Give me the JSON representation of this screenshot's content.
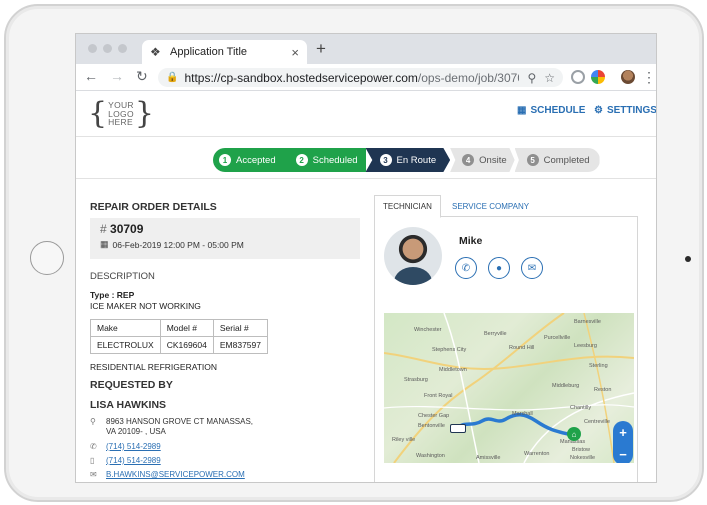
{
  "browser": {
    "tab_title": "Application Title",
    "tab_close": "×",
    "new_tab": "+",
    "url_host": "https://cp-sandbox.hostedservicepower.com",
    "url_path": "/ops-demo/job/3070..."
  },
  "header": {
    "logo_lines": [
      "YOUR",
      "LOGO",
      "HERE"
    ],
    "schedule_label": "SCHEDULE",
    "settings_label": "SETTINGS"
  },
  "status_steps": [
    {
      "num": "1",
      "label": "Accepted",
      "state": "done"
    },
    {
      "num": "2",
      "label": "Scheduled",
      "state": "done"
    },
    {
      "num": "3",
      "label": "En Route",
      "state": "current"
    },
    {
      "num": "4",
      "label": "Onsite",
      "state": "todo"
    },
    {
      "num": "5",
      "label": "Completed",
      "state": "todo"
    }
  ],
  "repair_order": {
    "heading": "REPAIR ORDER DETAILS",
    "hash": "#",
    "number": "30709",
    "date": "06-Feb-2019 12:00 PM - 05:00 PM"
  },
  "description": {
    "heading": "DESCRIPTION",
    "type": "Type : REP",
    "text": "ICE MAKER NOT WORKING",
    "columns": [
      "Make",
      "Model #",
      "Serial #"
    ],
    "row": [
      "ELECTROLUX",
      "CK169604",
      "EM837597"
    ],
    "category": "RESIDENTIAL REFRIGERATION"
  },
  "requested_by": {
    "heading": "REQUESTED BY",
    "name": "LISA HAWKINS",
    "address_line1": "8963 HANSON GROVE CT MANASSAS,",
    "address_line2": "VA 20109- , USA",
    "phone1": "(714) 514-2989",
    "phone2": "(714) 514-2989",
    "email": "B.HAWKINS@SERVICEPOWER.COM"
  },
  "technician_panel": {
    "tab_technician": "TECHNICIAN",
    "tab_company": "SERVICE COMPANY",
    "name": "Mike"
  },
  "map": {
    "labels": [
      "Winchester",
      "Berryville",
      "Purcellville",
      "Leesburg",
      "Barnesville",
      "Stephens City",
      "Round Hill",
      "Middletown",
      "Sterling",
      "Strasburg",
      "Middleburg",
      "Reston",
      "Front Royal",
      "Chantilly",
      "Chester Gap",
      "Marshall",
      "Centreville",
      "Bentonville",
      "Manassas",
      "Warrenton",
      "Bristow",
      "Washington",
      "Nokesville",
      "Amissville",
      "Riley ville"
    ],
    "zoom_in": "+",
    "zoom_out": "−",
    "route_color": "#2a7ad1"
  },
  "colors": {
    "accent": "#2a6fb3",
    "done": "#1fa24a",
    "current": "#1f3552"
  }
}
